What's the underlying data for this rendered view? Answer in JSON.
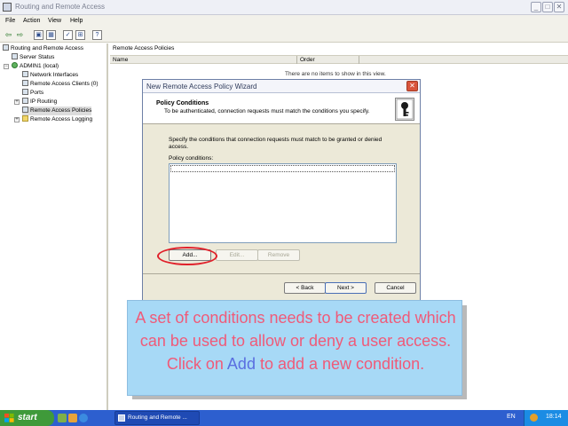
{
  "window": {
    "title": "Routing and Remote Access",
    "controls": {
      "minimize": "_",
      "maximize": "□",
      "close": "✕"
    }
  },
  "menu": [
    "File",
    "Action",
    "View",
    "Help"
  ],
  "toolbar": {
    "icons": [
      "back-arrow-icon",
      "forward-arrow-icon",
      "up-folder-icon",
      "show-hide-tree-icon",
      "properties-icon",
      "refresh-icon",
      "help-icon"
    ],
    "glyphs": [
      "⇦",
      "⇨",
      "▣",
      "▦",
      "✓",
      "⊞",
      "?"
    ]
  },
  "tree": {
    "root": "Routing and Remote Access",
    "items": [
      {
        "label": "Server Status"
      },
      {
        "label": "ADMIN1 (local)"
      },
      {
        "label": "Network Interfaces"
      },
      {
        "label": "Remote Access Clients (0)"
      },
      {
        "label": "Ports"
      },
      {
        "label": "IP Routing"
      },
      {
        "label": "Remote Access Policies"
      },
      {
        "label": "Remote Access Logging"
      }
    ],
    "expander_plus": "+",
    "expander_minus": "−"
  },
  "list": {
    "title": "Remote Access Policies",
    "columns": [
      "Name",
      "Order"
    ],
    "empty_message": "There are no items to show in this view."
  },
  "wizard": {
    "title": "New Remote Access Policy Wizard",
    "close": "✕",
    "heading": "Policy Conditions",
    "subheading": "To be authenticated, connection requests must match the conditions you specify.",
    "description_line1": "Specify the conditions that connection requests must match to be granted or denied",
    "description_line2": "access.",
    "conditions_label": "Policy conditions:",
    "buttons": {
      "add": "Add...",
      "edit": "Edit...",
      "remove": "Remove",
      "back": "< Back",
      "next": "Next >",
      "cancel": "Cancel"
    }
  },
  "callout": {
    "text_before": "A set of conditions needs to be created which can be used to allow or deny a user access. Click on ",
    "highlight": "Add",
    "text_after": " to add a new condition."
  },
  "taskbar": {
    "start_label": "start",
    "task_label": "Routing and Remote ...",
    "language": "EN",
    "clock": "18:14"
  },
  "colors": {
    "callout_background": "#a7d9f6",
    "callout_text": "#f05a78",
    "callout_highlight": "#5a6ee0",
    "highlight_ring": "#e0202a",
    "taskbar": "#2d5fcf",
    "start_button": "#3f9a3a"
  }
}
